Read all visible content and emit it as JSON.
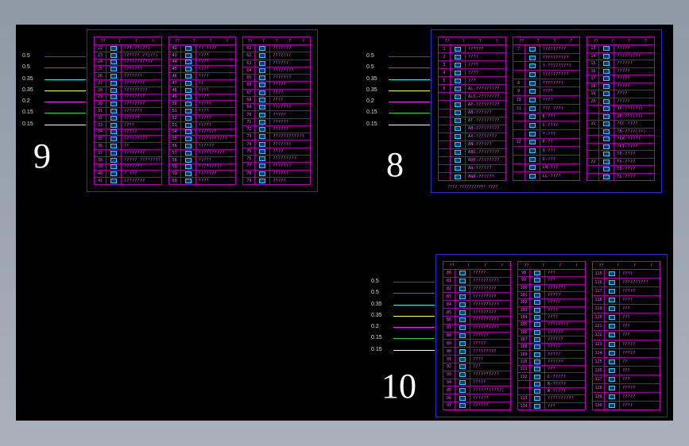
{
  "legend": [
    {
      "width": "0.5",
      "color": "#3b3bff"
    },
    {
      "width": "0.5",
      "color": "#ff2b2b"
    },
    {
      "width": "0.35",
      "color": "#33e6e6"
    },
    {
      "width": "0.35",
      "color": "#ffff33"
    },
    {
      "width": "0.2",
      "color": "#e433e4"
    },
    {
      "width": "0.15",
      "color": "#33cc33"
    },
    {
      "width": "0.15",
      "color": "#ffffff"
    }
  ],
  "sheets": [
    {
      "label": "9",
      "cols": [
        {
          "header": [
            "??",
            "?",
            "?",
            "?"
          ],
          "rows": [
            {
              "n": "22",
              "t": "???-??(??)"
            },
            {
              "n": "23",
              "t": "?????? ??(??)"
            },
            {
              "n": "24",
              "t": "???????????"
            },
            {
              "n": "25",
              "t": "???????"
            },
            {
              "n": "26",
              "t": "???????"
            },
            {
              "n": "27",
              "t": "????????"
            },
            {
              "n": "28",
              "t": "?????????"
            },
            {
              "n": "29",
              "t": "????????"
            },
            {
              "n": "30",
              "t": "????????"
            },
            {
              "n": "31",
              "t": "???????"
            },
            {
              "n": "32",
              "t": "??????"
            },
            {
              "n": "33",
              "t": "????"
            },
            {
              "n": "34",
              "t": "?????"
            },
            {
              "n": "35",
              "t": "?????????"
            },
            {
              "n": "36",
              "t": "??"
            },
            {
              "n": "37",
              "t": "????????"
            },
            {
              "n": "38",
              "t": "?????_????????"
            },
            {
              "n": "39",
              "t": "???????"
            },
            {
              "n": "40",
              "t": "?_???"
            },
            {
              "n": "41",
              "t": "????????"
            }
          ]
        },
        {
          "header": [
            "??",
            "?",
            "?",
            "?"
          ],
          "rows": [
            {
              "n": "42",
              "t": "??_????"
            },
            {
              "n": "43",
              "t": "????"
            },
            {
              "n": "44",
              "t": "????"
            },
            {
              "n": "45",
              "t": "????"
            },
            {
              "n": "46",
              "t": "????"
            },
            {
              "n": "47",
              "t": "??"
            },
            {
              "n": "48",
              "t": "????"
            },
            {
              "n": "49",
              "t": "????"
            },
            {
              "n": "50",
              "t": "?????"
            },
            {
              "n": "51",
              "t": "????"
            },
            {
              "n": "52",
              "t": "?????"
            },
            {
              "n": "53",
              "t": "?????"
            },
            {
              "n": "54",
              "t": "???????"
            },
            {
              "n": "55",
              "t": "???????????"
            },
            {
              "n": "56",
              "t": "??????"
            },
            {
              "n": "57",
              "t": "??????????"
            },
            {
              "n": "58",
              "t": "?????"
            },
            {
              "n": "59",
              "t": "?????????"
            },
            {
              "n": "59",
              "t": "???????"
            },
            {
              "n": "60",
              "t": "????"
            }
          ]
        },
        {
          "header": [
            "??",
            "?",
            "?",
            "?",
            "?"
          ],
          "rows": [
            {
              "n": "61",
              "t": "???????"
            },
            {
              "n": "62",
              "t": "???????"
            },
            {
              "n": "63",
              "t": "??????"
            },
            {
              "n": "64",
              "t": "????????"
            },
            {
              "n": "65",
              "t": "???????"
            },
            {
              "n": "66",
              "t": "?????"
            },
            {
              "n": "67",
              "t": "????"
            },
            {
              "n": "68",
              "t": "????"
            },
            {
              "n": "69",
              "t": "??/????"
            },
            {
              "n": "70",
              "t": "?????"
            },
            {
              "n": "71",
              "t": "??????"
            },
            {
              "n": "72",
              "t": "??????"
            },
            {
              "n": "73",
              "t": "????????????"
            },
            {
              "n": "74",
              "t": "???????"
            },
            {
              "n": "75",
              "t": "????"
            },
            {
              "n": "76",
              "t": "?????????"
            },
            {
              "n": "77",
              "t": "???????"
            },
            {
              "n": "78",
              "t": "??????"
            },
            {
              "n": "79",
              "t": "?????"
            }
          ]
        }
      ]
    },
    {
      "label": "8",
      "cols": [
        {
          "header": [
            "??",
            "?",
            "?",
            "?"
          ],
          "rows": [
            {
              "n": "1",
              "t": "??????"
            },
            {
              "n": "2",
              "t": "????"
            },
            {
              "n": "3",
              "t": "????"
            },
            {
              "n": "4",
              "t": "????"
            },
            {
              "n": "5",
              "t": "???"
            },
            {
              "n": "6",
              "t": "AL-?????????"
            },
            {
              "n": "",
              "t": "ALC-????????"
            },
            {
              "n": "",
              "t": "AP-?????????"
            },
            {
              "n": "",
              "t": "AB-??????"
            },
            {
              "n": "",
              "t": "AT-?????????"
            },
            {
              "n": "",
              "t": "AB-?????????"
            },
            {
              "n": "",
              "t": "AX-????????"
            },
            {
              "n": "",
              "t": "AN-??????"
            },
            {
              "n": "",
              "t": "ABC-????????"
            },
            {
              "n": "",
              "t": "ADP-????????"
            },
            {
              "n": "",
              "t": "AW-??????"
            },
            {
              "n": "",
              "t": "AWP-??????"
            }
          ]
        },
        {
          "header": [
            "??",
            "?",
            "?",
            "?"
          ],
          "rows": [
            {
              "n": "7",
              "t": "?????????"
            },
            {
              "n": "",
              "t": "??????????"
            },
            {
              "n": "",
              "t": "?-?????????"
            },
            {
              "n": "",
              "t": "??????????"
            },
            {
              "n": "8",
              "t": "????????"
            },
            {
              "n": "9",
              "t": "????"
            },
            {
              "n": "10",
              "t": "????"
            },
            {
              "n": "11",
              "t": "??? ????"
            },
            {
              "n": "",
              "t": "E-???"
            },
            {
              "n": "",
              "t": "S-????"
            },
            {
              "n": "",
              "t": "?-???"
            },
            {
              "n": "12",
              "t": "P-??"
            },
            {
              "n": "",
              "t": "Q-???"
            },
            {
              "n": "",
              "t": "D-???"
            },
            {
              "n": "",
              "t": "LN-???"
            },
            {
              "n": "",
              "t": "LL-????"
            }
          ]
        },
        {
          "header": [
            "??",
            "?",
            "?",
            "?"
          ],
          "rows": [
            {
              "n": "13",
              "t": "?????"
            },
            {
              "n": "14",
              "t": "?????????"
            },
            {
              "n": "15",
              "t": "??????"
            },
            {
              "n": "16",
              "t": "?????"
            },
            {
              "n": "17",
              "t": "?????"
            },
            {
              "n": "18",
              "t": "?????"
            },
            {
              "n": "19",
              "t": "????"
            },
            {
              "n": "20",
              "t": "?????"
            },
            {
              "n": "",
              "t": "JP-???(??)"
            },
            {
              "n": "",
              "t": "JP-???(??)"
            },
            {
              "n": "21",
              "t": "?CC-????"
            },
            {
              "n": "",
              "t": "?H-????(??)"
            },
            {
              "n": "",
              "t": "?CK-?????"
            },
            {
              "n": "",
              "t": "?PT-????"
            },
            {
              "n": "",
              "t": "TP-????"
            },
            {
              "n": "22",
              "t": "TV-????"
            },
            {
              "n": "",
              "t": "TD-????"
            },
            {
              "n": "",
              "t": "TL-????"
            }
          ]
        }
      ],
      "footer": "???? ??????????? ????"
    },
    {
      "label": "10",
      "cols": [
        {
          "header": [
            "??",
            "?",
            "?",
            "?"
          ],
          "rows": [
            {
              "n": "80",
              "t": "?????"
            },
            {
              "n": "81",
              "t": "??????????"
            },
            {
              "n": "82",
              "t": "?????????"
            },
            {
              "n": "83",
              "t": "?????????"
            },
            {
              "n": "84",
              "t": "??????????"
            },
            {
              "n": "85",
              "t": "?????????"
            },
            {
              "n": "86",
              "t": "??????????"
            },
            {
              "n": "87",
              "t": "??????????"
            },
            {
              "n": "88",
              "t": "??????"
            },
            {
              "n": "89",
              "t": "?????"
            },
            {
              "n": "90",
              "t": "?????????"
            },
            {
              "n": "91",
              "t": "????"
            },
            {
              "n": "92",
              "t": "???"
            },
            {
              "n": "93",
              "t": "??????????"
            },
            {
              "n": "94",
              "t": "?????"
            },
            {
              "n": "95",
              "t": "??????(????)"
            },
            {
              "n": "96",
              "t": "??????"
            },
            {
              "n": "97",
              "t": "??????"
            }
          ]
        },
        {
          "header": [
            "??",
            "?",
            "?",
            "?"
          ],
          "rows": [
            {
              "n": "98",
              "t": "???"
            },
            {
              "n": "99",
              "t": "???"
            },
            {
              "n": "100",
              "t": "???????"
            },
            {
              "n": "101",
              "t": "?????"
            },
            {
              "n": "102",
              "t": "?????"
            },
            {
              "n": "103",
              "t": "????"
            },
            {
              "n": "104",
              "t": "????"
            },
            {
              "n": "105",
              "t": "????????"
            },
            {
              "n": "106",
              "t": "??????"
            },
            {
              "n": "107",
              "t": "??????"
            },
            {
              "n": "108",
              "t": "?????"
            },
            {
              "n": "109",
              "t": "?????"
            },
            {
              "n": "110",
              "t": "??????"
            },
            {
              "n": "111",
              "t": "???"
            },
            {
              "n": "112",
              "t": "C-?????"
            },
            {
              "n": "",
              "t": "R-?????"
            },
            {
              "n": "",
              "t": "W-?????"
            },
            {
              "n": "113",
              "t": "??????????"
            },
            {
              "n": "114",
              "t": "???"
            }
          ]
        },
        {
          "header": [
            "??",
            "?",
            "?",
            "?"
          ],
          "rows": [
            {
              "n": "115",
              "t": "????"
            },
            {
              "n": "116",
              "t": "??????????"
            },
            {
              "n": "117",
              "t": "?????"
            },
            {
              "n": "118",
              "t": "????"
            },
            {
              "n": "119",
              "t": "???"
            },
            {
              "n": "120",
              "t": "???"
            },
            {
              "n": "121",
              "t": "???"
            },
            {
              "n": "122",
              "t": "???"
            },
            {
              "n": "123",
              "t": "?????"
            },
            {
              "n": "124",
              "t": "?????"
            },
            {
              "n": "125",
              "t": "??"
            },
            {
              "n": "126",
              "t": "???"
            },
            {
              "n": "127",
              "t": "???"
            },
            {
              "n": "128",
              "t": "?????"
            },
            {
              "n": "129",
              "t": "?????"
            },
            {
              "n": "130",
              "t": "????"
            }
          ]
        }
      ]
    }
  ]
}
